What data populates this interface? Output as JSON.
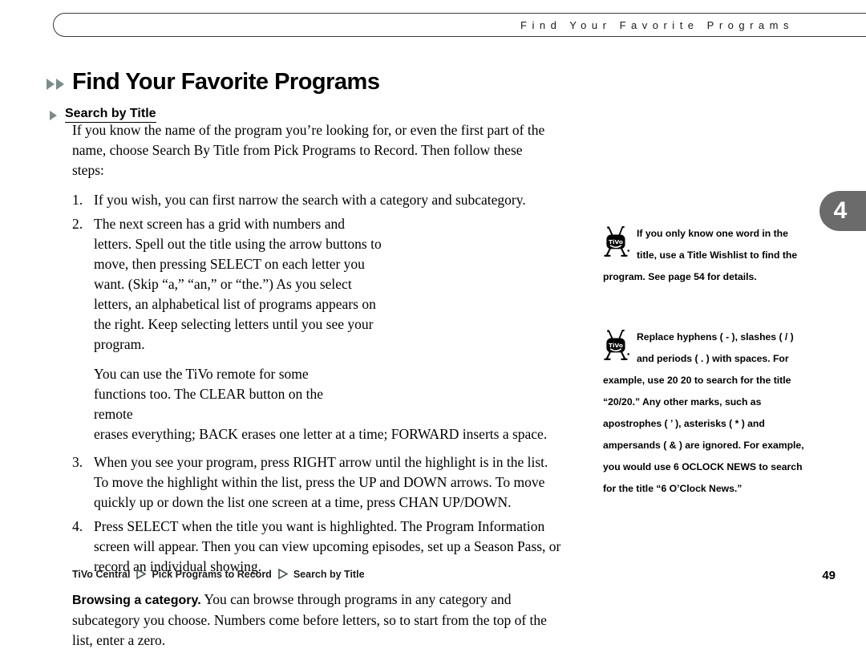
{
  "header": {
    "running_head": "Find Your Favorite Programs"
  },
  "chapter_tab": {
    "number": "4",
    "color": "#6b6b6b"
  },
  "title": {
    "text": "Find Your Favorite Programs",
    "arrow_color": "#7d8b8b"
  },
  "section": {
    "heading": "Search by Title",
    "intro": "If you know the name of the program you’re looking for, or even the first part of the name, choose Search By Title from Pick Programs to Record. Then follow these steps:"
  },
  "steps": [
    {
      "number": "1.",
      "text": "If you wish, you can first narrow the search with a category and subcategory."
    },
    {
      "number": "2.",
      "text": "The next screen has a grid with numbers and letters. Spell out the title using the arrow buttons to move, then pressing SELECT on each letter you want. (Skip “a,” “an,” or “the.”) As you select letters, an alphabetical list of programs appears on the right. Keep selecting letters until you see your program.",
      "continuation_narrow": "You can use the TiVo remote for some functions too. The CLEAR button on the remote",
      "continuation_wide": " erases everything; BACK erases one letter at a time; FORWARD inserts a space."
    },
    {
      "number": "3.",
      "text": "When you see your program, press RIGHT arrow until the highlight is in the list. To move the highlight within the list, press the UP and DOWN arrows. To move quickly up or down the list one screen at a time, press CHAN UP/DOWN."
    },
    {
      "number": "4.",
      "text": "Press SELECT when the title you want is highlighted. The Program Information screen will appear. Then you can view upcoming episodes, set up a Season Pass, or record an individual showing."
    }
  ],
  "browsing": {
    "lead": "Browsing a category.",
    "text": " You can browse through programs in any category and subcategory you choose. Numbers come before letters, so to start from the top of the list, enter a zero."
  },
  "tips": [
    {
      "icon": "tivo-mascot-icon",
      "text": "If you only know one word in the title, use a Title Wishlist to find the program. See page 54 for details."
    },
    {
      "icon": "tivo-mascot-icon",
      "text": "Replace hyphens ( - ), slashes ( / ) and periods ( . ) with spaces. For example, use 20 20 to search for the title “20/20.” Any other marks, such as apostrophes ( ’ ), asterisks ( * ) and ampersands ( & ) are ignored. For example, you would use 6 OCLOCK NEWS to search for the title “6 O’Clock News.”"
    }
  ],
  "footer": {
    "breadcrumbs": [
      "TiVo Central",
      "Pick Programs to Record",
      "Search by Title"
    ],
    "page_number": "49"
  }
}
